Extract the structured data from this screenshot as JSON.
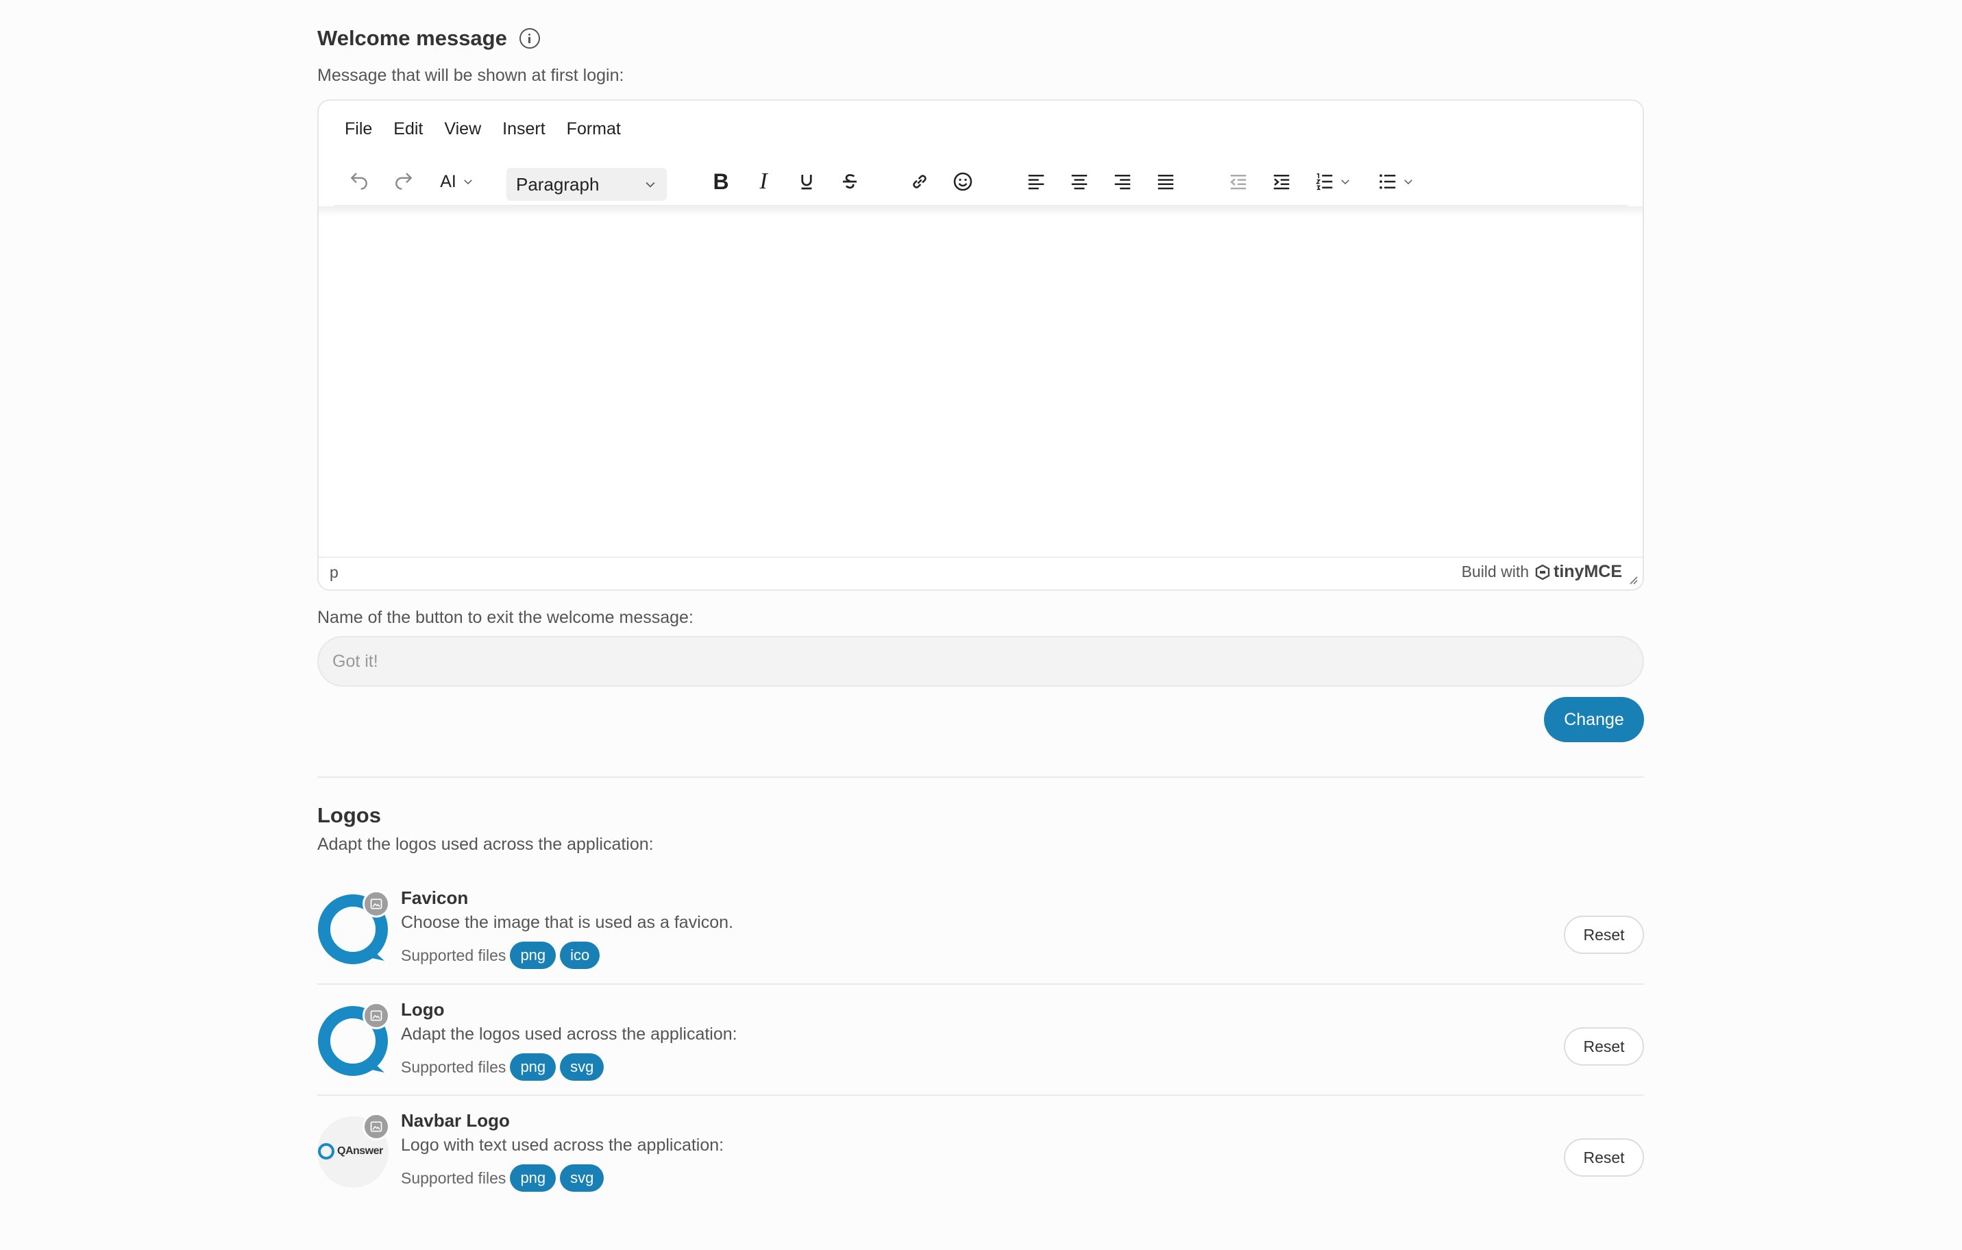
{
  "welcome": {
    "title": "Welcome message",
    "subtitle": "Message that will be shown at first login:"
  },
  "editor": {
    "menu": [
      "File",
      "Edit",
      "View",
      "Insert",
      "Format"
    ],
    "ai_label": "AI",
    "block_format": "Paragraph",
    "status_path": "p",
    "brand_text": "Build with",
    "brand_name": "tinyMCE"
  },
  "button_name": {
    "label": "Name of the button to exit the welcome message:",
    "placeholder": "Got it!",
    "value": ""
  },
  "change_button": "Change",
  "logos": {
    "title": "Logos",
    "subtitle": "Adapt the logos used across the application:",
    "supported_label": "Supported files",
    "reset_label": "Reset",
    "items": [
      {
        "title": "Favicon",
        "description": "Choose the image that is used as a favicon.",
        "files": [
          "png",
          "ico"
        ]
      },
      {
        "title": "Logo",
        "description": "Adapt the logos used across the application:",
        "files": [
          "png",
          "svg"
        ]
      },
      {
        "title": "Navbar Logo",
        "description": "Logo with text used across the application:",
        "files": [
          "png",
          "svg"
        ],
        "logo_text": "QAnswer"
      }
    ]
  },
  "colors": {
    "accent": "#1880b5",
    "logo_blue": "#1a8ac4"
  }
}
